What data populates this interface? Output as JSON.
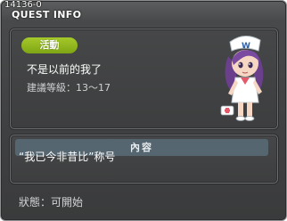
{
  "window": {
    "quest_id": "14136-0",
    "title": "QUEST INFO"
  },
  "info": {
    "badge": "活動",
    "quest_name": "不是以前的我了",
    "level_label": "建議等級：13～17",
    "npc_icon": "nurse-npc-sprite"
  },
  "content": {
    "header": "內容",
    "text": "“我已今非昔比”称号"
  },
  "status": {
    "text": "狀態：可開始"
  },
  "colors": {
    "badge_green": "#8db41c",
    "header_bg": "#566670",
    "window_bg": "#444546"
  }
}
